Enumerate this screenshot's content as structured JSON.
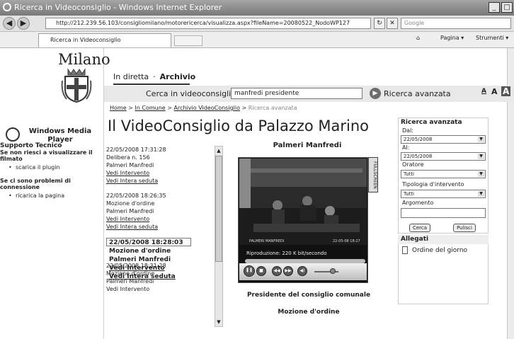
{
  "window": {
    "title": "Ricerca in Videoconsiglio - Windows Internet Explorer",
    "min_label": "_",
    "max_label": "□"
  },
  "addressbar": {
    "back": "◀",
    "forward": "▶",
    "url": "http://212.239.56.103/consigliomilano/motorericerca/visualizza.aspx?fileName=20080522_NodoWP127",
    "search_placeholder": "Google",
    "refresh": "↻",
    "stop": "✕"
  },
  "tabsbar": {
    "tab_label": "Ricerca in Videoconsiglio",
    "pagina": "Pagina ▾",
    "strumenti": "Strumenti ▾",
    "home_icon": "⌂",
    "print_icon": "🖶"
  },
  "site": {
    "city": "Milano",
    "player_name": "Windows Media Player",
    "support": {
      "title": "Supporto Tecnico",
      "q1": "Se non riesci a visualizzare il filmato",
      "a1": "scarica il plugin",
      "q2": "Se ci sono problemi di connessione",
      "a2": "ricarica la pagina"
    }
  },
  "nav": {
    "tab_live": "In diretta",
    "sep": "·",
    "tab_archive": "Archivio"
  },
  "search": {
    "label": "Cerca in videoconsiglio",
    "value": "manfredi presidente",
    "go": "▶",
    "advanced": "Ricerca avanzata",
    "font_small": "A",
    "font_medium": "A",
    "font_large": "A"
  },
  "breadcrumb": {
    "home": "Home",
    "comune": "In Comune",
    "archivio": "Archivio VideoConsiglio",
    "current": "Ricerca avanzata",
    "sep": ">"
  },
  "page_title": "Il VideoConsiglio da Palazzo Marino",
  "events": [
    {
      "datetime": "22/05/2008   17:31:28",
      "type": "Delibera n. 156",
      "speaker": "Palmeri Manfredi",
      "link1": "Vedi Intervento",
      "link2": "Vedi Intera seduta"
    },
    {
      "datetime": "22/05/2008   18:26:35",
      "type": "Mozione d'ordine",
      "speaker": "Palmeri Manfredi",
      "link1": "Vedi Intervento",
      "link2": "Vedi Intera seduta"
    },
    {
      "datetime": "22/05/2008   18:28:03",
      "type": "Mozione d'ordine",
      "speaker": "Palmeri Manfredi",
      "link1": "Vedi Intervento",
      "link2": "Vedi Intera seduta"
    },
    {
      "datetime": "22/05/2008   18:31:28",
      "type": "Mozione d'ordine",
      "speaker": "Palmeri Manfredi",
      "link1": "Vedi Intervento",
      "link2": ""
    }
  ],
  "player": {
    "speaker": "Palmeri Manfredi",
    "fullscreen": "FULLSCREEN",
    "overlay_name": "PALMERI MANFREDI",
    "overlay_date": "22-05-08 18:27",
    "playback": "Riproduzione: 220 K bit/secondo",
    "caption1": "Presidente del consiglio comunale",
    "caption2": "Mozione d'ordine",
    "pause": "❚❚",
    "stop": "■",
    "prev": "◀◀",
    "next": "▶▶",
    "mute": "◀)"
  },
  "advanced_panel": {
    "title": "Ricerca avanzata",
    "dal_label": "Dal:",
    "dal_value": "22/05/2008",
    "al_label": "Al:",
    "al_value": "22/05/2008",
    "oratore_label": "Oratore",
    "oratore_value": "Tutti",
    "tipologia_label": "Tipologia d'intervento",
    "tipologia_value": "Tutti",
    "argomento_label": "Argomento",
    "cerca": "Cerca",
    "pulisci": "Pulisci"
  },
  "allegati": {
    "title": "Allegati",
    "item": "Ordine del giorno"
  }
}
